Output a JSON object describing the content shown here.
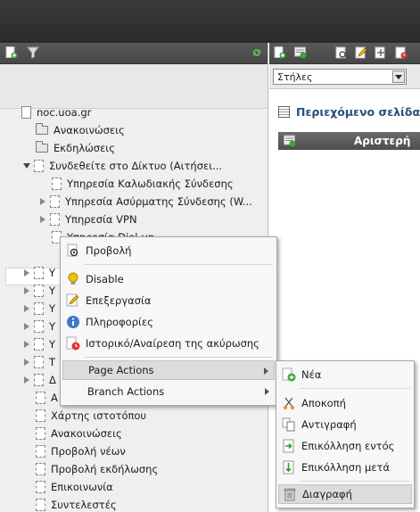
{
  "colors": {
    "accent_heading": "#2a4f7a",
    "toolbar_dark": "#4e4e4e"
  },
  "right_panel": {
    "columns_select": "Στήλες",
    "content_heading": "Περιεχόμενο σελίδας",
    "column_header": "Αριστερή"
  },
  "tree": {
    "root": "noc.uoa.gr",
    "items": [
      {
        "label": "Ανακοινώσεις"
      },
      {
        "label": "Εκδηλώσεις"
      },
      {
        "label": "Συνδεθείτε στο Δίκτυο (Αιτήσει..."
      },
      {
        "label": "Υπηρεσία Καλωδιακής Σύνδεσης"
      },
      {
        "label": "Υπηρεσία Ασύρματης Σύνδεσης (W..."
      },
      {
        "label": "Υπηρεσία VPN"
      },
      {
        "label": "Υπηρεσία Dial-up"
      },
      {
        "label": "Υ"
      },
      {
        "label": "Υ"
      },
      {
        "label": "Υ"
      },
      {
        "label": "Υ"
      },
      {
        "label": "Υ"
      },
      {
        "label": "Τ"
      },
      {
        "label": "Δ"
      },
      {
        "label": "Α"
      },
      {
        "label": "Χάρτης ιστοτόπου"
      },
      {
        "label": "Ανακοινώσεις"
      },
      {
        "label": "Προβολή νέων"
      },
      {
        "label": "Προβολή εκδήλωσης"
      },
      {
        "label": "Επικοινωνία"
      },
      {
        "label": "Συντελεστές"
      }
    ]
  },
  "context_menu": {
    "view": "Προβολή",
    "disable": "Disable",
    "edit": "Επεξεργασία",
    "info": "Πληροφορίες",
    "history": "Ιστορικό/Αναίρεση της ακύρωσης",
    "page_actions": "Page Actions",
    "branch_actions": "Branch Actions"
  },
  "submenu": {
    "new": "Νέα",
    "cut": "Αποκοπή",
    "copy": "Αντιγραφή",
    "paste_into": "Επικόλληση εντός",
    "paste_after": "Επικόλληση μετά",
    "delete": "Διαγραφή"
  }
}
